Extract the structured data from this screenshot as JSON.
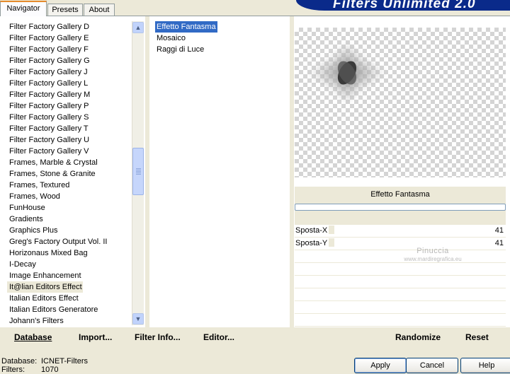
{
  "app": {
    "banner_title": "Filters Unlimited 2.0"
  },
  "tabs": [
    {
      "label": "Navigator",
      "active": true
    },
    {
      "label": "Presets",
      "active": false
    },
    {
      "label": "About",
      "active": false
    }
  ],
  "categories": {
    "items": [
      "Filter Factory Gallery D",
      "Filter Factory Gallery E",
      "Filter Factory Gallery F",
      "Filter Factory Gallery G",
      "Filter Factory Gallery J",
      "Filter Factory Gallery L",
      "Filter Factory Gallery M",
      "Filter Factory Gallery P",
      "Filter Factory Gallery S",
      "Filter Factory Gallery T",
      "Filter Factory Gallery U",
      "Filter Factory Gallery V",
      "Frames, Marble & Crystal",
      "Frames, Stone & Granite",
      "Frames, Textured",
      "Frames, Wood",
      "FunHouse",
      "Gradients",
      "Graphics Plus",
      "Greg's Factory Output Vol. II",
      "Horizonaus Mixed Bag",
      "I-Decay",
      "Image Enhancement",
      "It@lian Editors Effect",
      "Italian Editors Effect",
      "Italian Editors Generatore",
      "Johann's Filters"
    ],
    "selected": "It@lian Editors Effect",
    "scroll_up_icon": "arrow-up-icon",
    "scroll_down_icon": "arrow-down-icon"
  },
  "filters": {
    "items": [
      "Effetto Fantasma",
      "Mosaico",
      "Raggi di Luce"
    ],
    "selected": "Effetto Fantasma"
  },
  "preview": {
    "filter_name": "Effetto Fantasma",
    "progress": 0
  },
  "params": [
    {
      "label": "Sposta-X",
      "value": "41"
    },
    {
      "label": "Sposta-Y",
      "value": "41"
    }
  ],
  "watermark": {
    "name": "Pinuccia",
    "url": "www.mardiregrafica.eu"
  },
  "toolbar": {
    "database": "Database",
    "import": "Import...",
    "filter_info": "Filter Info...",
    "editor": "Editor...",
    "randomize": "Randomize",
    "reset": "Reset"
  },
  "status": {
    "database_label": "Database:",
    "database_value": "ICNET-Filters",
    "filters_label": "Filters:",
    "filters_value": "1070"
  },
  "dialog": {
    "apply": "Apply",
    "cancel": "Cancel",
    "help": "Help"
  }
}
